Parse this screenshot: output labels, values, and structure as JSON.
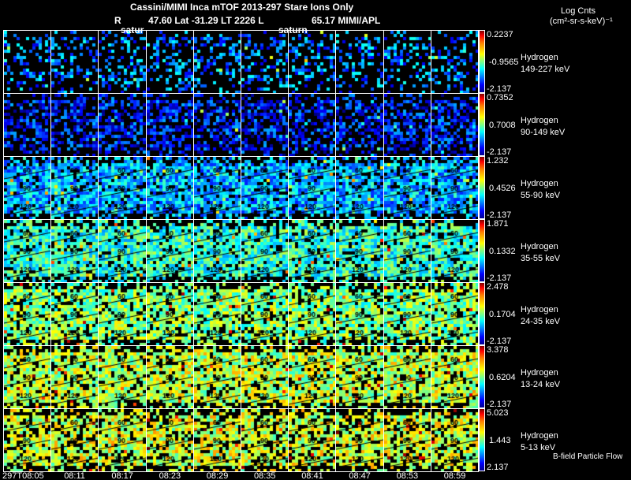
{
  "title_line1": "Cassini/MIMI Inca mTOF  2013-297   Stare   Ions Only",
  "title_line2": {
    "r": "R",
    "mid": "47.60 Lat -31.29 LT 2226 L",
    "right": "65.17  MIMI/APL"
  },
  "overlay_labels": [
    "satur",
    "saturn"
  ],
  "units": {
    "line1": "Log Cnts",
    "line2": "(cm²-sr-s-keV)⁻¹"
  },
  "footer_note": "B-field Particle Flow",
  "chart_data": {
    "type": "heatmap",
    "title": "Cassini/MIMI Inca mTOF 2013-297 Stare Ions Only",
    "columns": [
      "297T08:05",
      "08:11",
      "08:17",
      "08:23",
      "08:29",
      "08:35",
      "08:41",
      "08:47",
      "08:53",
      "08:59"
    ],
    "contour_labels": [
      "60",
      "90",
      "120"
    ],
    "rows": [
      {
        "species": "Hydrogen",
        "energy": "149-227 keV",
        "max": "0.2237",
        "mid": "-0.9565",
        "min": "-2.137",
        "level": 0.25,
        "fill": 0.35
      },
      {
        "species": "Hydrogen",
        "energy": "90-149 keV",
        "max": "0.7352",
        "mid": "0.7008",
        "min": "-2.137",
        "level": 0.15,
        "fill": 0.55
      },
      {
        "species": "Hydrogen",
        "energy": "55-90 keV",
        "max": "1.232",
        "mid": "0.4526",
        "min": "-2.137",
        "level": 0.3,
        "fill": 0.85
      },
      {
        "species": "Hydrogen",
        "energy": "35-55 keV",
        "max": "1.871",
        "mid": "0.1332",
        "min": "-2.137",
        "level": 0.42,
        "fill": 0.85
      },
      {
        "species": "Hydrogen",
        "energy": "24-35 keV",
        "max": "2.478",
        "mid": "0.1704",
        "min": "-2.137",
        "level": 0.5,
        "fill": 0.8
      },
      {
        "species": "Hydrogen",
        "energy": "13-24 keV",
        "max": "3.378",
        "mid": "0.6204",
        "min": "-2.137",
        "level": 0.56,
        "fill": 0.82
      },
      {
        "species": "Hydrogen",
        "energy": "5-13 keV",
        "max": "5.023",
        "mid": "1.443",
        "min": "2.137",
        "level": 0.58,
        "fill": 0.75
      }
    ]
  }
}
